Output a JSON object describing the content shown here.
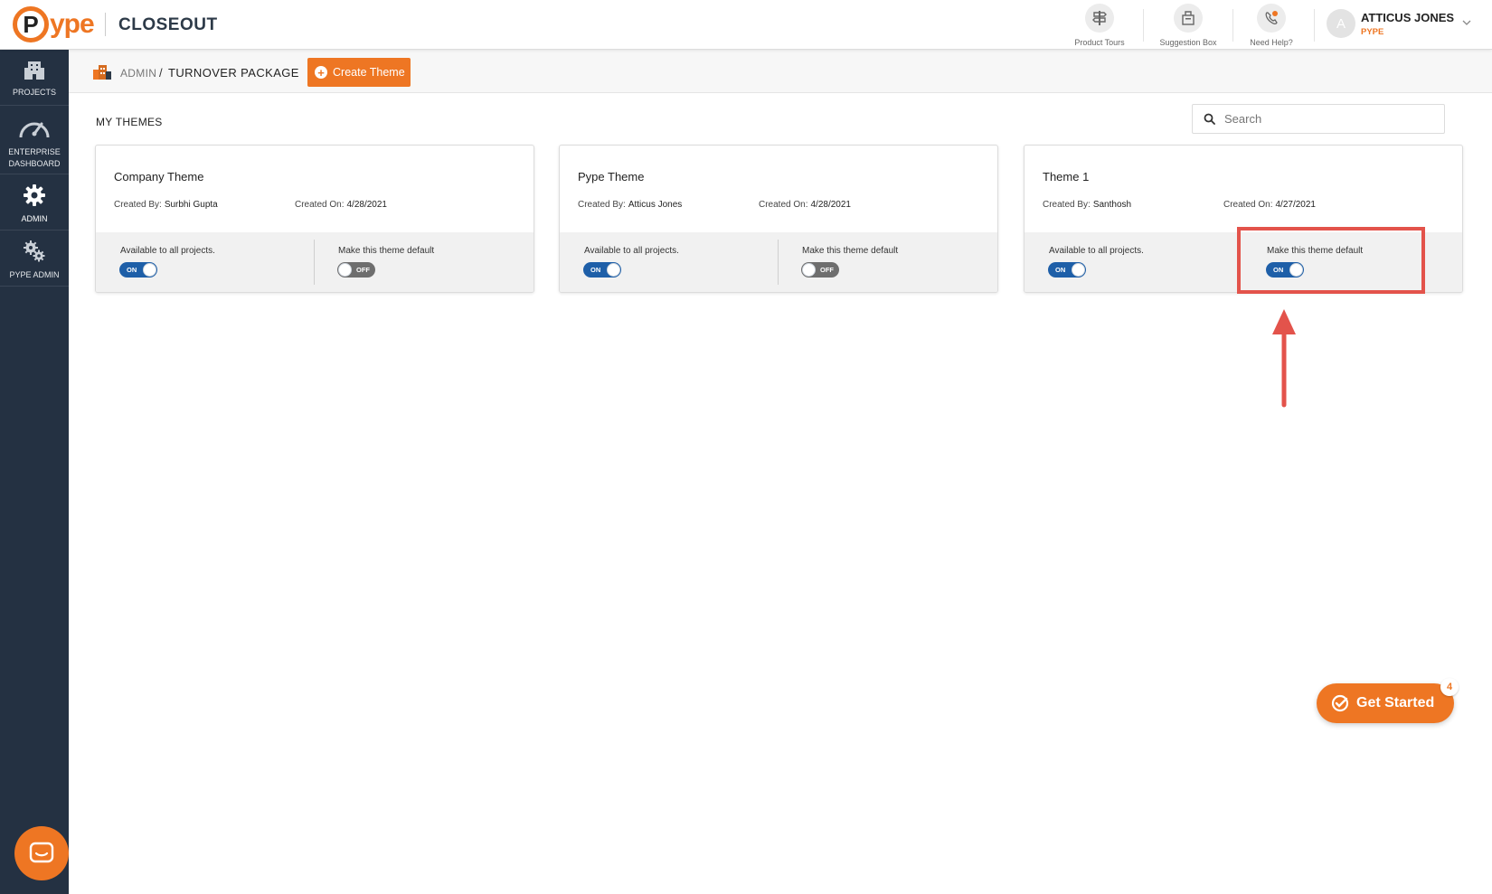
{
  "header": {
    "logo_o": "P",
    "logo_text": "ype",
    "product": "CLOSEOUT",
    "utilities": [
      {
        "label": "Product Tours",
        "icon": "signpost-icon"
      },
      {
        "label": "Suggestion Box",
        "icon": "suggestion-box-icon"
      },
      {
        "label": "Need Help?",
        "icon": "phone-help-icon"
      }
    ],
    "user": {
      "initial": "A",
      "name": "ATTICUS JONES",
      "org": "PYPE"
    }
  },
  "sidebar": {
    "items": [
      {
        "label": "PROJECTS",
        "icon": "building-icon",
        "active": false
      },
      {
        "label": "ENTERPRISE DASHBOARD",
        "icon": "speedometer-icon",
        "active": false
      },
      {
        "label": "ADMIN",
        "icon": "gear-icon",
        "active": true
      },
      {
        "label": "PYPE ADMIN",
        "icon": "gears-icon",
        "active": false
      }
    ]
  },
  "breadcrumb": {
    "parent": "ADMIN",
    "separator": "/",
    "current": "TURNOVER PACKAGE"
  },
  "toolbar": {
    "create_label": "Create Theme"
  },
  "themes_section": {
    "title": "MY THEMES"
  },
  "search": {
    "placeholder": "Search",
    "value": ""
  },
  "themes": [
    {
      "name": "Company Theme",
      "created_by_label": "Created By:",
      "created_by": "Surbhi Gupta",
      "created_on_label": "Created On:",
      "created_on": "4/28/2021",
      "available_label": "Available to all projects.",
      "available": "ON",
      "default_label": "Make this theme default",
      "default": "OFF"
    },
    {
      "name": "Pype Theme",
      "created_by_label": "Created By:",
      "created_by": "Atticus Jones",
      "created_on_label": "Created On:",
      "created_on": "4/28/2021",
      "available_label": "Available to all projects.",
      "available": "ON",
      "default_label": "Make this theme default",
      "default": "OFF"
    },
    {
      "name": "Theme 1",
      "created_by_label": "Created By:",
      "created_by": "Santhosh",
      "created_on_label": "Created On:",
      "created_on": "4/27/2021",
      "available_label": "Available to all projects.",
      "available": "ON",
      "default_label": "Make this theme default",
      "default": "ON"
    }
  ],
  "get_started": {
    "label": "Get Started",
    "badge": "4"
  },
  "colors": {
    "brand_orange": "#ee7623",
    "sidebar_bg": "#243142",
    "toggle_on": "#1e5fa8",
    "toggle_off": "#6e6e6e",
    "annotation_red": "#e3534b"
  }
}
